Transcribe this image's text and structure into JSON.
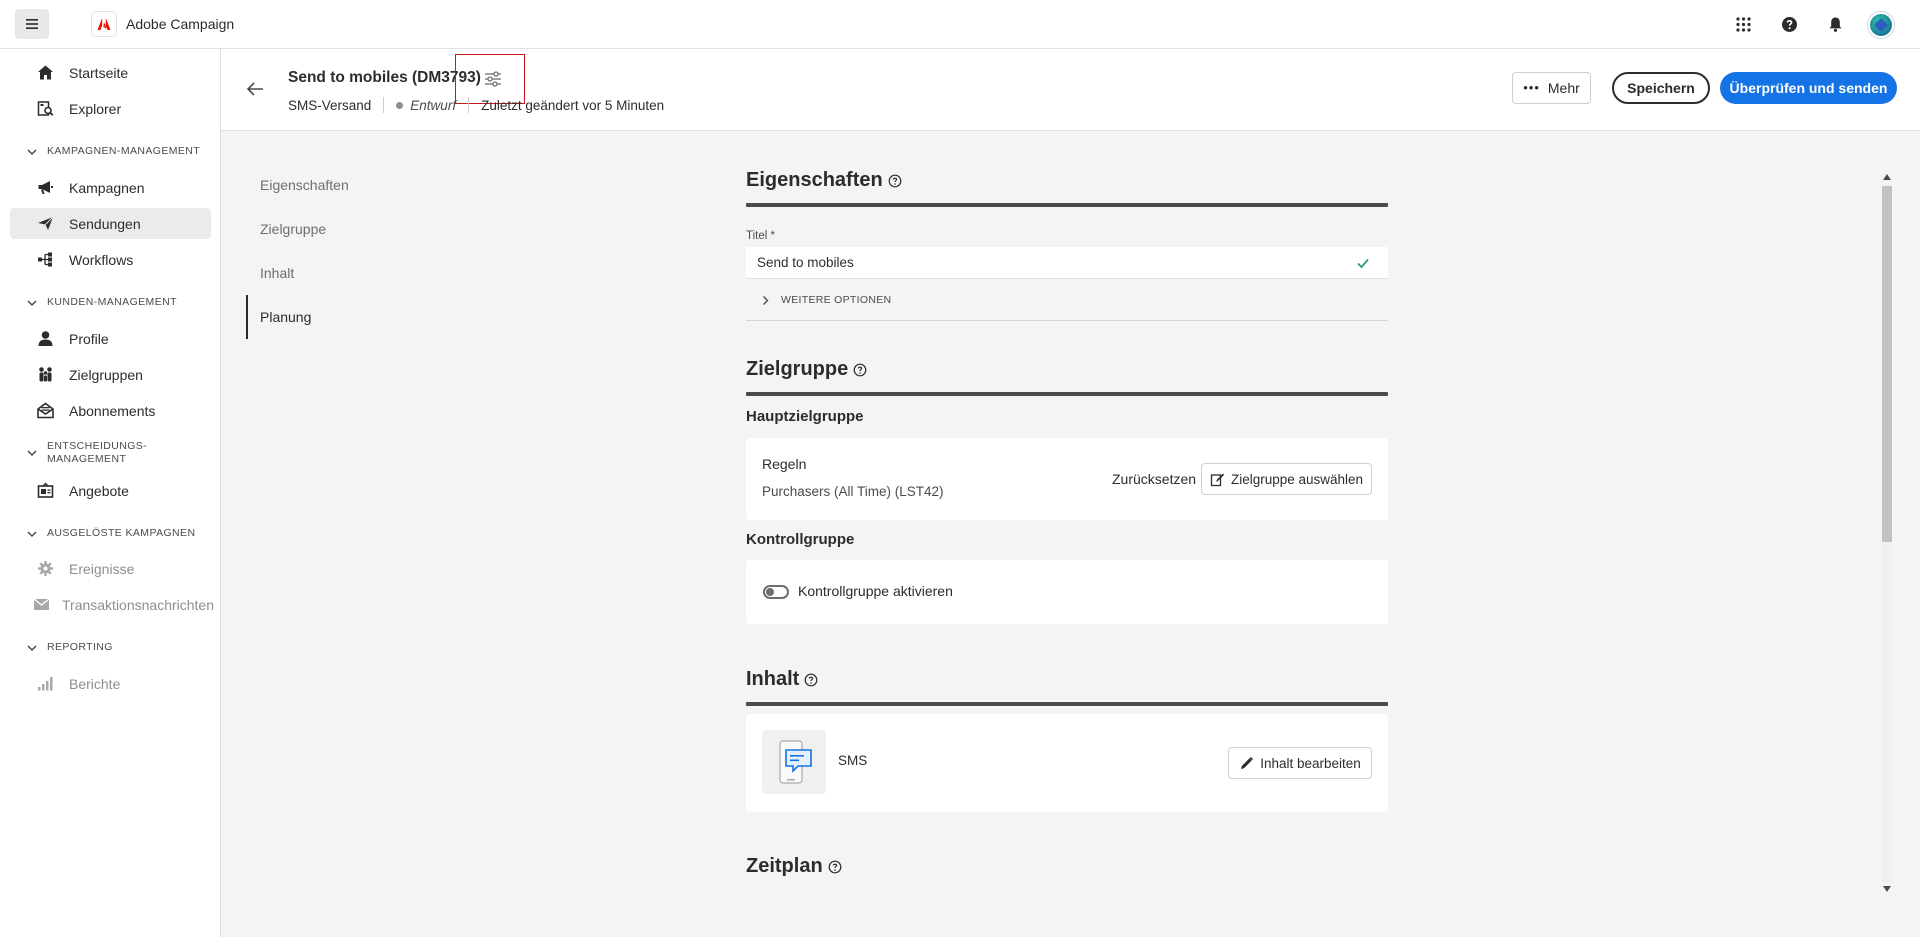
{
  "app": {
    "name": "Adobe Campaign",
    "brand_color": "#eb1000",
    "accent_color": "#1473e6"
  },
  "topbar": {
    "menu_icon": "hamburger-icon",
    "icons": [
      "apps-grid-icon",
      "help-icon",
      "bell-icon",
      "avatar"
    ]
  },
  "sidebar": {
    "items": [
      {
        "label": "Startseite",
        "icon": "home-icon"
      },
      {
        "label": "Explorer",
        "icon": "explorer-icon"
      },
      {
        "label": "Kampagnen",
        "icon": "megaphone-icon"
      },
      {
        "label": "Sendungen",
        "icon": "send-icon",
        "active": true
      },
      {
        "label": "Workflows",
        "icon": "workflow-icon"
      },
      {
        "label": "Profile",
        "icon": "user-icon"
      },
      {
        "label": "Zielgruppen",
        "icon": "audience-icon"
      },
      {
        "label": "Abonnements",
        "icon": "mail-open-icon"
      },
      {
        "label": "Angebote",
        "icon": "offer-icon"
      },
      {
        "label": "Ereignisse",
        "icon": "gear-icon",
        "disabled": true
      },
      {
        "label": "Transaktionsnachrichten",
        "icon": "envelope-icon",
        "disabled": true
      },
      {
        "label": "Berichte",
        "icon": "bar-chart-icon",
        "disabled": true
      }
    ],
    "sections": [
      {
        "label": "KAMPAGNEN-MANAGEMENT"
      },
      {
        "label": "KUNDEN-MANAGEMENT"
      },
      {
        "label": "ENTSCHEIDUNGS-\nMANAGEMENT"
      },
      {
        "label": "AUSGELÖSTE KAMPAGNEN"
      },
      {
        "label": "REPORTING"
      }
    ]
  },
  "header": {
    "title": "Send to mobiles (DM3793)",
    "type": "SMS-Versand",
    "status": "Entwurf",
    "modified": "Zuletzt geändert vor 5 Minuten",
    "more_label": "Mehr",
    "save_label": "Speichern",
    "send_label": "Überprüfen und senden"
  },
  "steps": [
    "Eigenschaften",
    "Zielgruppe",
    "Inhalt",
    "Planung"
  ],
  "active_step": "Planung",
  "properties": {
    "title": "Eigenschaften",
    "field_label": "Titel",
    "required_mark": "*",
    "field_value": "Send to mobiles",
    "more_options": "WEITERE OPTIONEN"
  },
  "audience": {
    "title": "Zielgruppe",
    "main_heading": "Hauptzielgruppe",
    "rules_label": "Regeln",
    "rules_value": "Purchasers (All Time) (LST42)",
    "reset_label": "Zurücksetzen",
    "select_label": "Zielgruppe auswählen",
    "control_heading": "Kontrollgruppe",
    "control_toggle_label": "Kontrollgruppe aktivieren",
    "control_enabled": false
  },
  "content": {
    "title": "Inhalt",
    "channel_label": "SMS",
    "edit_label": "Inhalt bearbeiten"
  },
  "schedule": {
    "title": "Zeitplan"
  }
}
